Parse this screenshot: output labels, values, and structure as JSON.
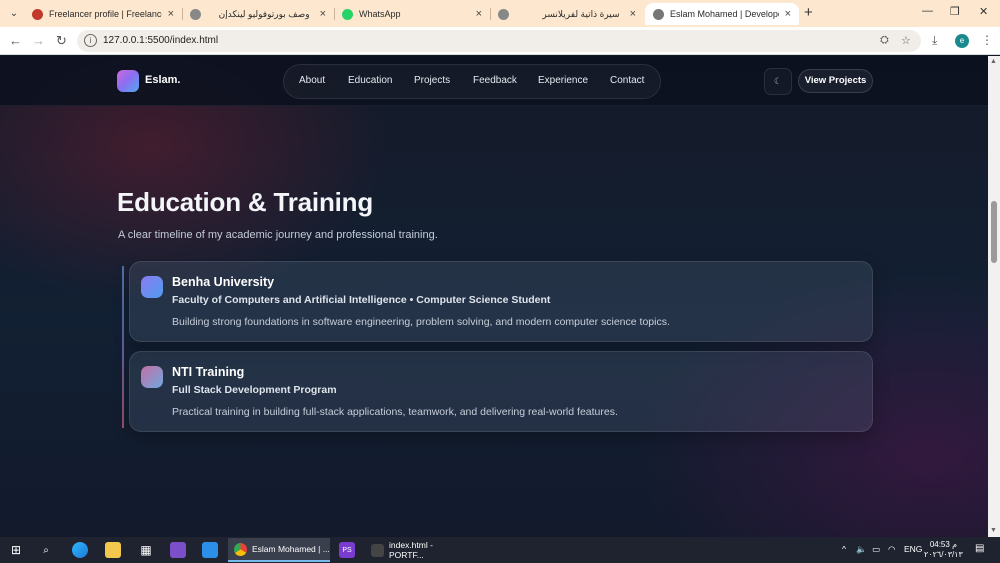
{
  "browser": {
    "tabs": [
      {
        "title": "Freelancer profile | Freelance Y",
        "active": false
      },
      {
        "title": "وصف بورتوفوليو لينكدإن",
        "active": false
      },
      {
        "title": "WhatsApp",
        "active": false
      },
      {
        "title": "سيرة ذاتية لفريلانسر",
        "active": false
      },
      {
        "title": "Eslam Mohamed | Developer P",
        "active": true
      }
    ],
    "url": "127.0.0.1:5500/index.html",
    "profile_initial": "e"
  },
  "site": {
    "logo": "Eslam.",
    "nav": [
      "About",
      "Education",
      "Projects",
      "Feedback",
      "Experience",
      "Contact"
    ],
    "cta": "View Projects"
  },
  "section": {
    "title": "Education & Training",
    "subtitle": "A clear timeline of my academic journey and professional training.",
    "items": [
      {
        "org": "Benha University",
        "role": "Faculty of Computers and Artificial Intelligence • Computer Science Student",
        "desc": "Building strong foundations in software engineering, problem solving, and modern computer science topics.",
        "dot_color_a": "#7f7df0",
        "dot_color_b": "#4f9cf0"
      },
      {
        "org": "NTI Training",
        "role": "Full Stack Development Program",
        "desc": "Practical training in building full-stack applications, teamwork, and delivering real-world features.",
        "dot_color_a": "#c46fa4",
        "dot_color_b": "#6fa8e0"
      }
    ]
  },
  "taskbar": {
    "apps": [
      {
        "title": "Eslam Mohamed | ...",
        "active": true
      },
      {
        "title": "index.html - PORTF...",
        "active": false
      }
    ],
    "lang": "ENG",
    "time": "04:53 م",
    "date": "٢٠٢٦/٠٣/١٣"
  }
}
